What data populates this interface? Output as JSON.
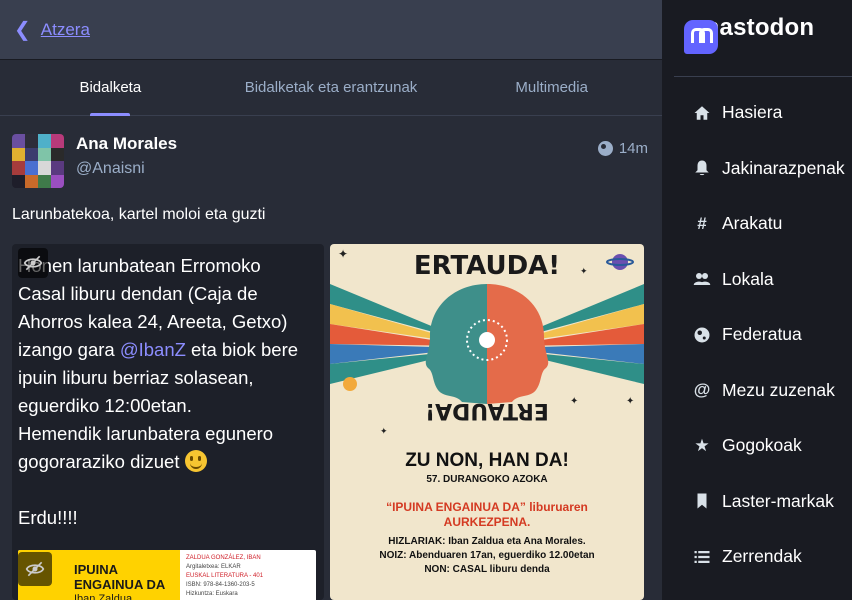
{
  "header": {
    "back_label": "Atzera"
  },
  "tabs": [
    {
      "label": "Bidalketa",
      "active": true
    },
    {
      "label": "Bidalketak eta erantzunak",
      "active": false
    },
    {
      "label": "Multimedia",
      "active": false
    }
  ],
  "status": {
    "display_name": "Ana Morales",
    "acct": "@Anaisni",
    "visibility_icon": "globe-icon",
    "time": "14m",
    "text": "Larunbatekoa, kartel moloi eta guzti"
  },
  "media_text": {
    "line1": "Honen larunbatean Erromoko",
    "line2": "Casal liburu dendan (Caja de",
    "line3": "Ahorros kalea 24, Areeta, Getxo)",
    "line4_prefix": "izango gara ",
    "mention": "@IbanZ",
    "line4_suffix": " eta biok bere",
    "line5": "ipuin liburu berriaz solasean,",
    "line6": "eguerdiko 12:00etan.",
    "line7": "Hemendik larunbatera egunero",
    "line8": "gogoraraziko dizuet",
    "line9": "Erdu!!!!"
  },
  "book": {
    "title": "IPUINA ENGAINUA DA",
    "author": "Iban Zaldua",
    "meta1": "ZALDUA GONZÁLEZ, IBAN",
    "meta2": "Argitaletxea: ELKAR",
    "meta3": "EUSKAL LITERATURA - 401",
    "meta4": "ISBN: 978-84-1360-203-5",
    "meta5": "Hizkuntza: Euskara"
  },
  "poster": {
    "top_word": "ERTAUDA!",
    "bottom_word": "ERTAUDA!",
    "headline": "ZU NON, HAN DA!",
    "subheadline": "57. DURANGOKO AZOKA",
    "red_line1": "“IPUINA ENGAINUA DA” liburuaren",
    "red_line2": "AURKEZPENA.",
    "info1": "HIZLARIAK: Iban Zaldua eta Ana Morales.",
    "info2": "NOIZ: Abenduaren 17an, eguerdiko 12.00etan",
    "info3": "NON: CASAL liburu denda"
  },
  "sidebar": {
    "brand": "mastodon",
    "nav": [
      {
        "label": "Hasiera",
        "icon": "home-icon"
      },
      {
        "label": "Jakinarazpenak",
        "icon": "bell-icon"
      },
      {
        "label": "Arakatu",
        "icon": "hashtag-icon"
      },
      {
        "label": "Lokala",
        "icon": "users-icon"
      },
      {
        "label": "Federatua",
        "icon": "globe-icon"
      },
      {
        "label": "Mezu zuzenak",
        "icon": "at-icon"
      },
      {
        "label": "Gogokoak",
        "icon": "star-icon"
      },
      {
        "label": "Laster-markak",
        "icon": "bookmark-icon"
      },
      {
        "label": "Zerrendak",
        "icon": "list-icon"
      }
    ]
  },
  "colors": {
    "accent": "#8c8dff",
    "brand": "#6364ff",
    "background": "#282c37",
    "sidebar_bg": "#191b22"
  }
}
